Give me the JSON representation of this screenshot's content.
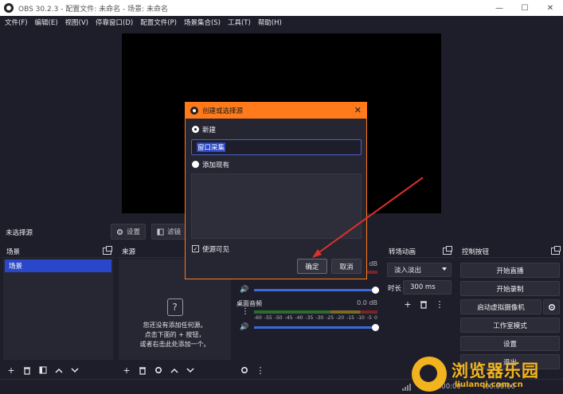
{
  "window": {
    "title": "OBS 30.2.3 - 配置文件: 未命名 - 场景: 未命名",
    "minimize": "—",
    "maximize": "☐",
    "close": "✕"
  },
  "menu": [
    "文件(F)",
    "编辑(E)",
    "视图(V)",
    "停靠窗口(D)",
    "配置文件(P)",
    "场景集合(S)",
    "工具(T)",
    "帮助(H)"
  ],
  "source_bar": {
    "no_source": "未选择源",
    "settings": "设置",
    "filters": "滤镜"
  },
  "scenes": {
    "title": "场景",
    "items": [
      "场景"
    ]
  },
  "sources": {
    "title": "来源",
    "empty_line1": "您还没有添加任何源。",
    "empty_line2": "点击下面的 + 按钮，",
    "empty_line3": "或者右击此处添加一个。"
  },
  "mixer": {
    "ch1_db": "0.0 dB",
    "ch2_name": "桌面音频",
    "ch2_db": "0.0 dB",
    "scale": [
      "-60",
      "-55",
      "-50",
      "-45",
      "-40",
      "-35",
      "-30",
      "-25",
      "-20",
      "-15",
      "-10",
      "-5",
      "0"
    ]
  },
  "transitions": {
    "title": "转场动画",
    "selected": "淡入淡出",
    "duration_label": "时长",
    "duration_value": "300 ms"
  },
  "controls": {
    "title": "控制按钮",
    "start_stream": "开始直播",
    "start_record": "开始录制",
    "start_virtualcam": "启动虚拟摄像机",
    "studio_mode": "工作室模式",
    "settings": "设置",
    "exit": "退出"
  },
  "status": {
    "time1": "00:00:00",
    "time2": "00:00:00"
  },
  "dialog": {
    "title": "创建或选择源",
    "new_label": "新建",
    "name_value": "窗口采集",
    "add_existing_label": "添加现有",
    "visible_label": "使源可见",
    "ok": "确定",
    "cancel": "取消"
  },
  "watermark": {
    "text": "浏览器乐园",
    "sub": "liulanqi.com.cn"
  },
  "colors": {
    "accent_orange": "#ff7a1a",
    "selection_blue": "#2a47c9",
    "background": "#1e1e2a",
    "arrow_red": "#e0302a",
    "watermark_gold": "#f2b41e"
  }
}
